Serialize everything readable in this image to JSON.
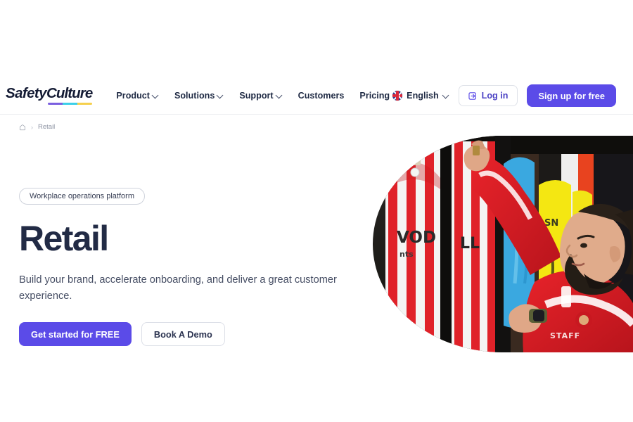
{
  "brand": {
    "logo_part1": "Safety",
    "logo_part2": "Culture",
    "accent_purple": "#7b5fe0",
    "accent_cyan": "#3ccfe8",
    "accent_yellow": "#f5d04e",
    "primary_button_color": "#5b4be8"
  },
  "header": {
    "nav": [
      {
        "label": "Product",
        "has_dropdown": true
      },
      {
        "label": "Solutions",
        "has_dropdown": true
      },
      {
        "label": "Support",
        "has_dropdown": true
      },
      {
        "label": "Customers",
        "has_dropdown": false
      },
      {
        "label": "Pricing",
        "has_dropdown": false
      }
    ],
    "language": {
      "label": "English",
      "icon": "uk-flag-icon"
    },
    "login_label": "Log in",
    "login_icon": "login-arrow-icon",
    "signup_label": "Sign up for free"
  },
  "breadcrumb": {
    "home_icon": "home-icon",
    "separator": "›",
    "current": "Retail"
  },
  "hero": {
    "eyebrow": "Workplace operations platform",
    "title": "Retail",
    "subtitle": "Build your brand, accelerate onboarding, and deliver a great customer experience.",
    "primary_cta": "Get started for FREE",
    "secondary_cta": "Book A Demo",
    "image_alt": "retail-store-worker-arranging-jerseys"
  }
}
